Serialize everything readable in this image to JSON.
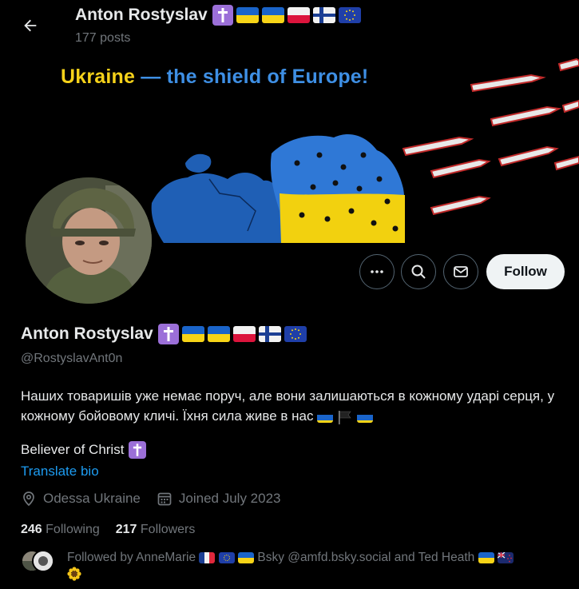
{
  "header": {
    "name": "Anton Rostyslav",
    "posts": "177 posts"
  },
  "banner": {
    "headline_a": "Ukraine",
    "headline_b": " — the shield of Europe!"
  },
  "actions": {
    "follow_label": "Follow"
  },
  "profile": {
    "name": "Anton Rostyslav",
    "handle": "@RostyslavAnt0n",
    "bio": "Наших товаришів уже немає поруч, але вони залишаються в кожному ударі серця, у кожному бойовому кличі. Їхня сила живе в нас",
    "believer": "Believer of Christ",
    "translate": "Translate bio",
    "location": "Odessa Ukraine",
    "joined": "Joined July 2023"
  },
  "stats": {
    "following_count": "246",
    "following_label": "Following",
    "followers_count": "217",
    "followers_label": "Followers"
  },
  "followed_by": {
    "prefix": "Followed by AnneMarie",
    "middle": "Bsky @amfd.bsky.social and Ted Heath"
  },
  "colors": {
    "background": "#000000",
    "accent": "#1d9bf0",
    "banner_yellow": "#f6d21a",
    "banner_blue": "#3e8fe4"
  },
  "icons": [
    "back-arrow-icon",
    "more-icon",
    "search-icon",
    "mail-icon",
    "location-icon",
    "calendar-icon"
  ]
}
